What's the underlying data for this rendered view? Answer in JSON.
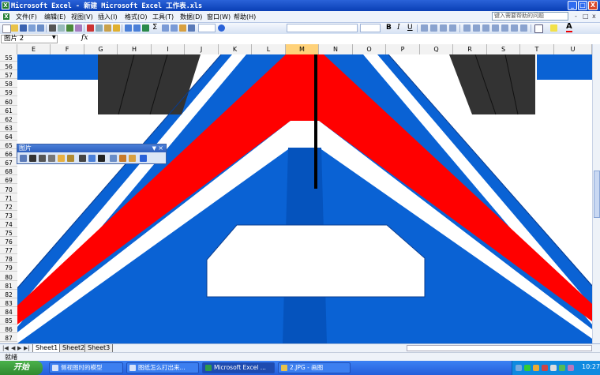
{
  "window": {
    "title": "Microsoft Excel - 新建 Microsoft Excel 工作表.xls",
    "controls": [
      "_",
      "□",
      "X"
    ]
  },
  "menubar": {
    "items": [
      "文件(F)",
      "编辑(E)",
      "视图(V)",
      "插入(I)",
      "格式(O)",
      "工具(T)",
      "数据(D)",
      "窗口(W)",
      "帮助(H)"
    ],
    "help_placeholder": "键入需要帮助的问题",
    "doc_controls": [
      "-",
      "□",
      "x"
    ]
  },
  "formulabar": {
    "namebox": "图片 2",
    "fx": "fx",
    "dropdown": "▼"
  },
  "toolbar": {
    "sum": "Σ",
    "bold": "B",
    "italic": "I",
    "underline": "U",
    "font_color_label": "A",
    "accent": "#2a62d8"
  },
  "columns": [
    "E",
    "F",
    "G",
    "H",
    "I",
    "J",
    "K",
    "L",
    "M",
    "N",
    "O",
    "P",
    "Q",
    "R",
    "S",
    "T",
    "U"
  ],
  "selected_column": "M",
  "rows": [
    "55",
    "56",
    "57",
    "58",
    "59",
    "60",
    "61",
    "62",
    "63",
    "64",
    "65",
    "66",
    "67",
    "68",
    "69",
    "70",
    "71",
    "72",
    "73",
    "74",
    "75",
    "76",
    "77",
    "78",
    "79",
    "80",
    "81",
    "82",
    "83",
    "84",
    "85",
    "86",
    "87"
  ],
  "picture_toolbar": {
    "title": "图片",
    "close": "×",
    "dropdown": "▼"
  },
  "sheets": {
    "tabs": [
      "Sheet1",
      "Sheet2",
      "Sheet3"
    ],
    "active": "Sheet1",
    "nav": [
      "|◀",
      "◀",
      "▶",
      "▶|"
    ]
  },
  "status": {
    "text": "就绪"
  },
  "taskbar": {
    "start": "开始",
    "tasks": [
      "侧视图时的模型",
      "图纸怎么打出来...",
      "Microsoft Excel ...",
      "2.JPG - 画图"
    ],
    "active_task": 2,
    "clock": "10:27"
  },
  "drawing_colors": {
    "blue": "#0a62d4",
    "dark_blue": "#0553bd",
    "red": "#ff0000",
    "white": "#ffffff",
    "dark_gray": "#333333",
    "black": "#000000"
  }
}
